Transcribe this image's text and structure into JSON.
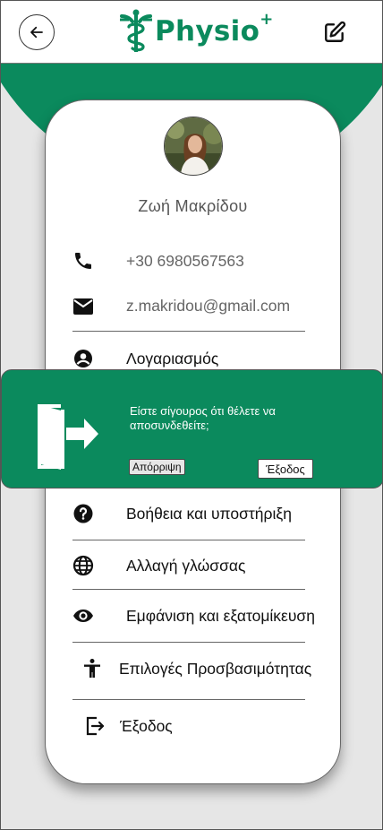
{
  "header": {
    "logo_text": "Physio",
    "logo_sup": "+",
    "back_icon": "arrow-left-icon",
    "edit_icon": "edit-icon"
  },
  "profile": {
    "name": "Ζωή Μακρίδου",
    "phone": "+30 6980567563",
    "email": "z.makridou@gmail.com"
  },
  "menu": [
    {
      "icon": "account-icon",
      "label": "Λογαριασμός"
    },
    {
      "icon": "help-icon",
      "label": "Βοήθεια και υποστήριξη"
    },
    {
      "icon": "globe-icon",
      "label": "Αλλαγή γλώσσας"
    },
    {
      "icon": "eye-icon",
      "label": "Εμφάνιση και εξατομίκευση"
    },
    {
      "icon": "accessibility-icon",
      "label": "Επιλογές Προσβασιμότητας"
    },
    {
      "icon": "logout-icon",
      "label": "Έξοδος"
    }
  ],
  "dialog": {
    "message": "Είστε σίγουρος ότι θέλετε να αποσυνδεθείτε;",
    "cancel_label": "Απόρριψη",
    "confirm_label": "Έξοδος"
  },
  "colors": {
    "brand_green": "#0b8a5d",
    "background": "#e6e6e6"
  }
}
